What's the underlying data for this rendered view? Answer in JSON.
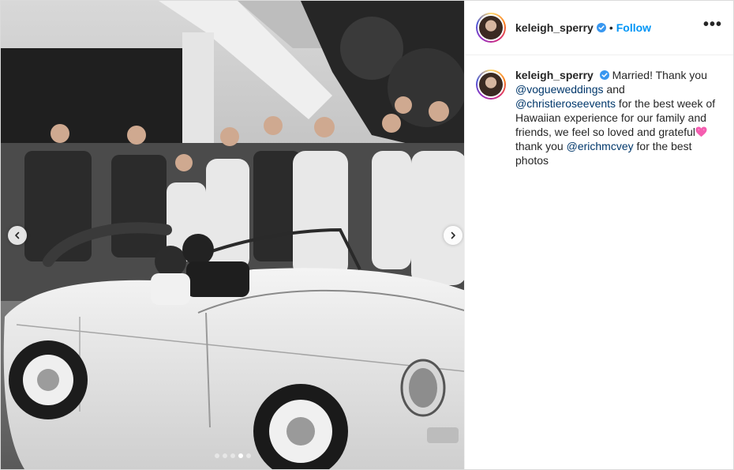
{
  "post": {
    "author": {
      "username": "keleigh_sperry",
      "verified": true,
      "follow_label": "Follow",
      "separator": "•",
      "more_label": "•••"
    },
    "carousel": {
      "total_slides": 5,
      "active_slide": 4
    },
    "caption": {
      "username": "keleigh_sperry",
      "text_1": "Married! Thank you ",
      "mention_1": "@vogueweddings",
      "text_2": " and ",
      "mention_2": "@christieroseevents",
      "text_3": " for the best week of Hawaiian experience for our family and friends, we feel so loved and grateful",
      "emoji": "pink-heart",
      "text_4": " thank you ",
      "mention_3": "@erichmcvey",
      "text_5": " for the best photos"
    }
  },
  "colors": {
    "link_blue": "#0095f6",
    "mention_blue": "#00376b",
    "verified_blue": "#3897f0",
    "text": "#262626",
    "heart_pink": "#f55db0"
  }
}
